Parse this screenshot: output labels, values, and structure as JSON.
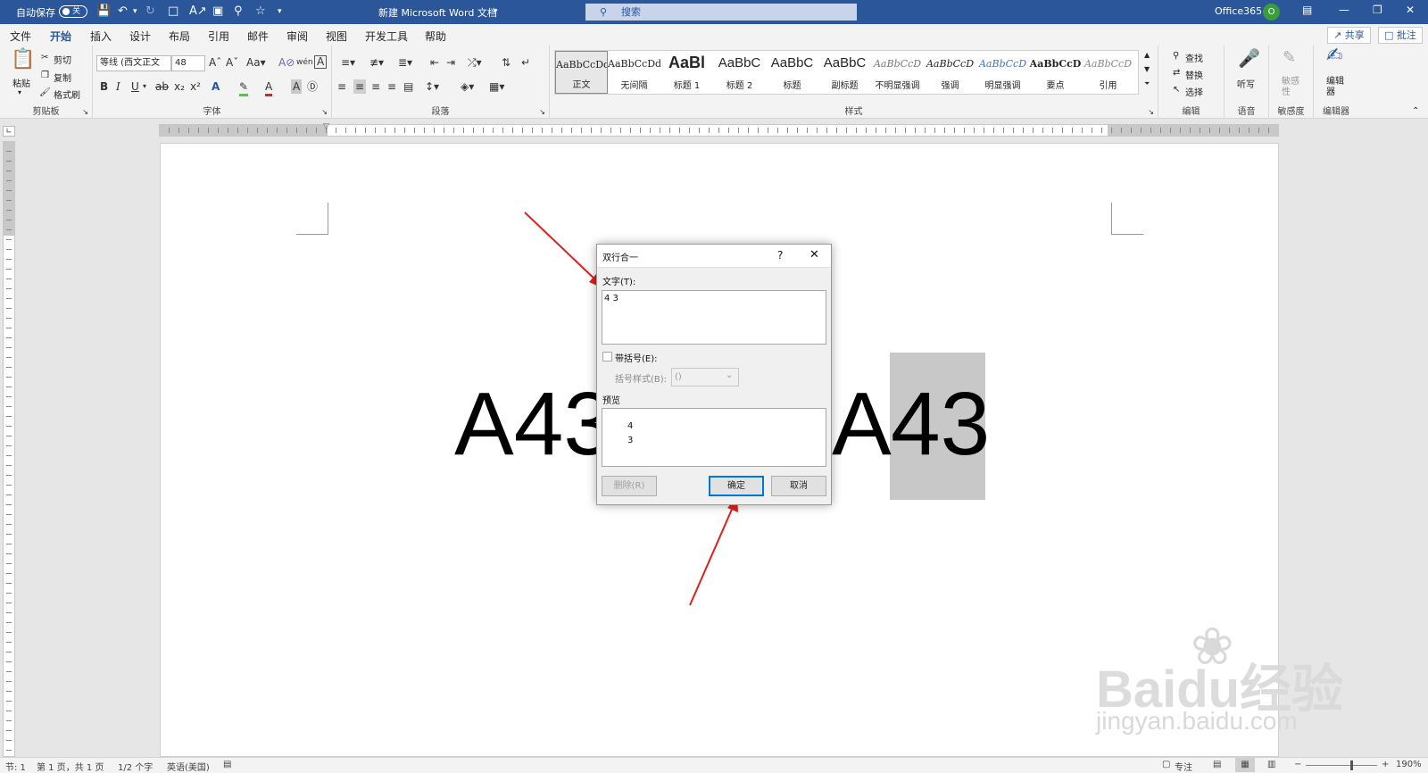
{
  "titlebar": {
    "autosave_label": "自动保存",
    "autosave_state": "关",
    "doc_title": "新建 Microsoft Word 文档",
    "search_placeholder": "搜索",
    "account_name": "Office365",
    "account_initial": "O",
    "brand_color": "#2b579a"
  },
  "tabs": [
    {
      "label": "文件"
    },
    {
      "label": "开始",
      "active": true
    },
    {
      "label": "插入"
    },
    {
      "label": "设计"
    },
    {
      "label": "布局"
    },
    {
      "label": "引用"
    },
    {
      "label": "邮件"
    },
    {
      "label": "审阅"
    },
    {
      "label": "视图"
    },
    {
      "label": "开发工具"
    },
    {
      "label": "帮助"
    }
  ],
  "top_actions": {
    "share": "共享",
    "comments": "批注"
  },
  "ribbon": {
    "clipboard": {
      "paste": "粘贴",
      "cut": "剪切",
      "copy": "复制",
      "format_painter": "格式刷",
      "label": "剪贴板"
    },
    "font": {
      "font_name": "等线 (西文正文",
      "font_size": "48",
      "label": "字体"
    },
    "paragraph": {
      "label": "段落"
    },
    "styles": {
      "label": "样式",
      "items": [
        {
          "preview": "AaBbCcDd",
          "name": "正文"
        },
        {
          "preview": "AaBbCcDd",
          "name": "无间隔"
        },
        {
          "preview": "AaBl",
          "name": "标题 1"
        },
        {
          "preview": "AaBbC",
          "name": "标题 2"
        },
        {
          "preview": "AaBbC",
          "name": "标题"
        },
        {
          "preview": "AaBbC",
          "name": "副标题"
        },
        {
          "preview": "AaBbCcD",
          "name": "不明显强调"
        },
        {
          "preview": "AaBbCcD",
          "name": "强调"
        },
        {
          "preview": "AaBbCcD",
          "name": "明显强调"
        },
        {
          "preview": "AaBbCcD",
          "name": "要点"
        },
        {
          "preview": "AaBbCcD",
          "name": "引用"
        }
      ]
    },
    "editing": {
      "find": "查找",
      "replace": "替换",
      "select": "选择",
      "label": "编辑"
    },
    "voice": {
      "dictate": "听写",
      "label": "语音"
    },
    "sensitivity": {
      "button": "敏感性",
      "label": "敏感度"
    },
    "editor": {
      "button": "编辑器",
      "label": "编辑器"
    }
  },
  "document": {
    "text_left": "A43",
    "text_right_a": "A",
    "text_right_selected": "43"
  },
  "dialog": {
    "title": "双行合一",
    "help": "?",
    "text_label": "文字(T):",
    "text_value": "4 3",
    "bracket_checkbox_label": "带括号(E):",
    "bracket_checked": false,
    "bracket_style_label": "括号样式(B):",
    "bracket_style_value": "()",
    "preview_label": "预览",
    "preview_line1": "4",
    "preview_line2": "3",
    "delete_button": "删除(R)",
    "ok_button": "确定",
    "cancel_button": "取消"
  },
  "status_bar": {
    "section": "节: 1",
    "page": "第 1 页，共 1 页",
    "words": "1/2 个字",
    "language": "英语(美国)",
    "focus": "专注",
    "zoom": "190%"
  },
  "watermark": {
    "brand": "Baidu经验",
    "url": "jingyan.baidu.com"
  },
  "annotation_color": "#e0201c"
}
